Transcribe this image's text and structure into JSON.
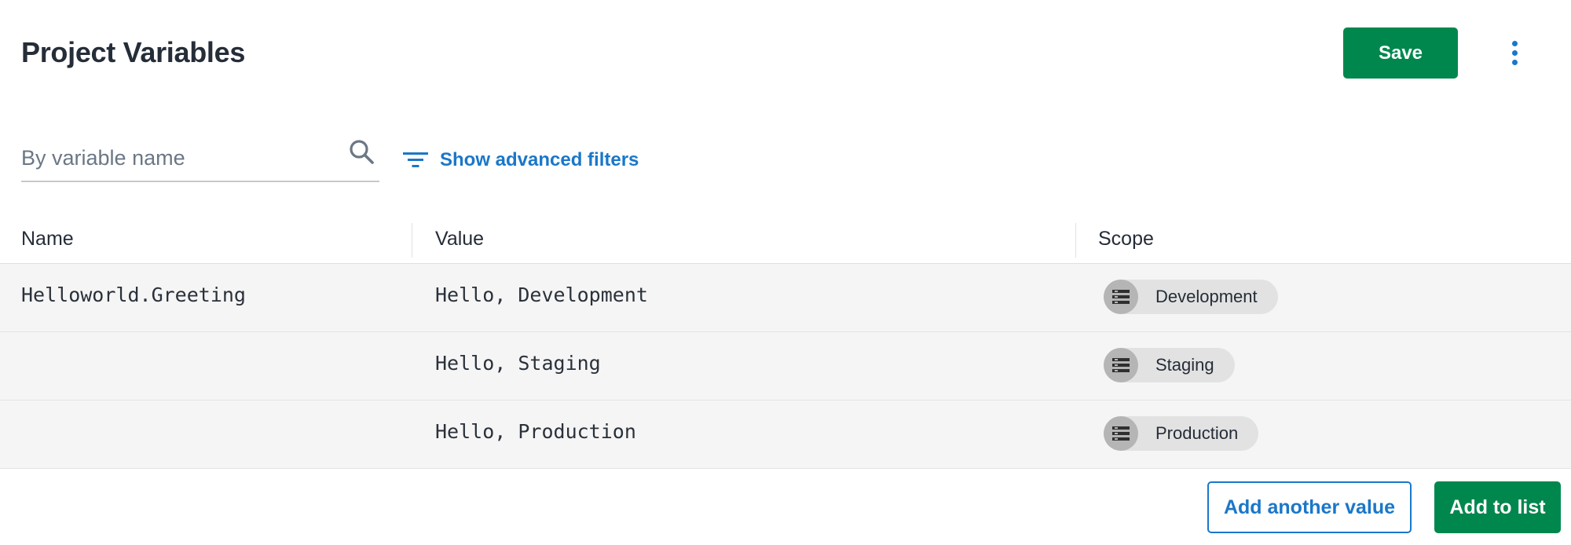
{
  "header": {
    "title": "Project Variables",
    "save_label": "Save",
    "more_icon": "kebab-menu-icon"
  },
  "search": {
    "placeholder": "By variable name",
    "value": "",
    "icon": "search-icon"
  },
  "filters": {
    "label": "Show advanced filters",
    "icon": "filter-icon"
  },
  "table": {
    "columns": [
      "Name",
      "Value",
      "Scope"
    ],
    "rows": [
      {
        "name": "Helloworld.Greeting",
        "value": "Hello, Development",
        "scope": "Development",
        "scope_icon": "environment-icon"
      },
      {
        "name": "",
        "value": "Hello, Staging",
        "scope": "Staging",
        "scope_icon": "environment-icon"
      },
      {
        "name": "",
        "value": "Hello, Production",
        "scope": "Production",
        "scope_icon": "environment-icon"
      }
    ]
  },
  "footer": {
    "add_value_label": "Add another value",
    "add_list_label": "Add to list"
  },
  "colors": {
    "primary_green": "#00874d",
    "link_blue": "#1a77c9",
    "row_background": "#f5f5f5",
    "chip_background": "#e2e2e2"
  }
}
